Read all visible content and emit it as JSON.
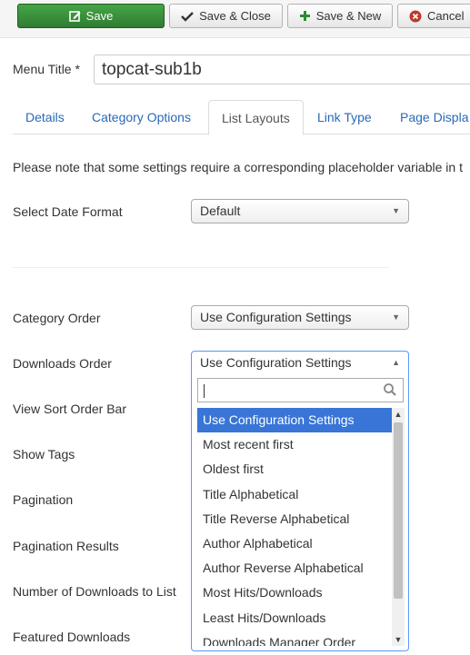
{
  "toolbar": {
    "save_label": "Save",
    "save_close_label": "Save & Close",
    "save_new_label": "Save & New",
    "cancel_label": "Cancel"
  },
  "menu_title": {
    "label": "Menu Title *",
    "value": "topcat-sub1b"
  },
  "tabs": [
    {
      "label": "Details"
    },
    {
      "label": "Category Options"
    },
    {
      "label": "List Layouts"
    },
    {
      "label": "Link Type"
    },
    {
      "label": "Page Displa"
    }
  ],
  "active_tab": "List Layouts",
  "note": "Please note that some settings require a corresponding placeholder variable in t",
  "fields": {
    "date_format": {
      "label": "Select Date Format",
      "value": "Default"
    },
    "category_order": {
      "label": "Category Order",
      "value": "Use Configuration Settings"
    },
    "downloads_order": {
      "label": "Downloads Order",
      "value": "Use Configuration Settings"
    },
    "view_sort_order_bar": {
      "label": "View Sort Order Bar"
    },
    "show_tags": {
      "label": "Show Tags"
    },
    "pagination": {
      "label": "Pagination"
    },
    "pagination_results": {
      "label": "Pagination Results"
    },
    "number_of_downloads": {
      "label": "Number of Downloads to List"
    },
    "featured_downloads": {
      "label": "Featured Downloads"
    }
  },
  "dropdown": {
    "search_value": "",
    "options": [
      "Use Configuration Settings",
      "Most recent first",
      "Oldest first",
      "Title Alphabetical",
      "Title Reverse Alphabetical",
      "Author Alphabetical",
      "Author Reverse Alphabetical",
      "Most Hits/Downloads",
      "Least Hits/Downloads",
      "Downloads Manager Order"
    ],
    "selected_index": 0
  },
  "colors": {
    "save_green": "#46a546",
    "link_blue": "#2a69b8",
    "highlight_blue": "#3875d7",
    "cancel_red": "#c0392b"
  }
}
